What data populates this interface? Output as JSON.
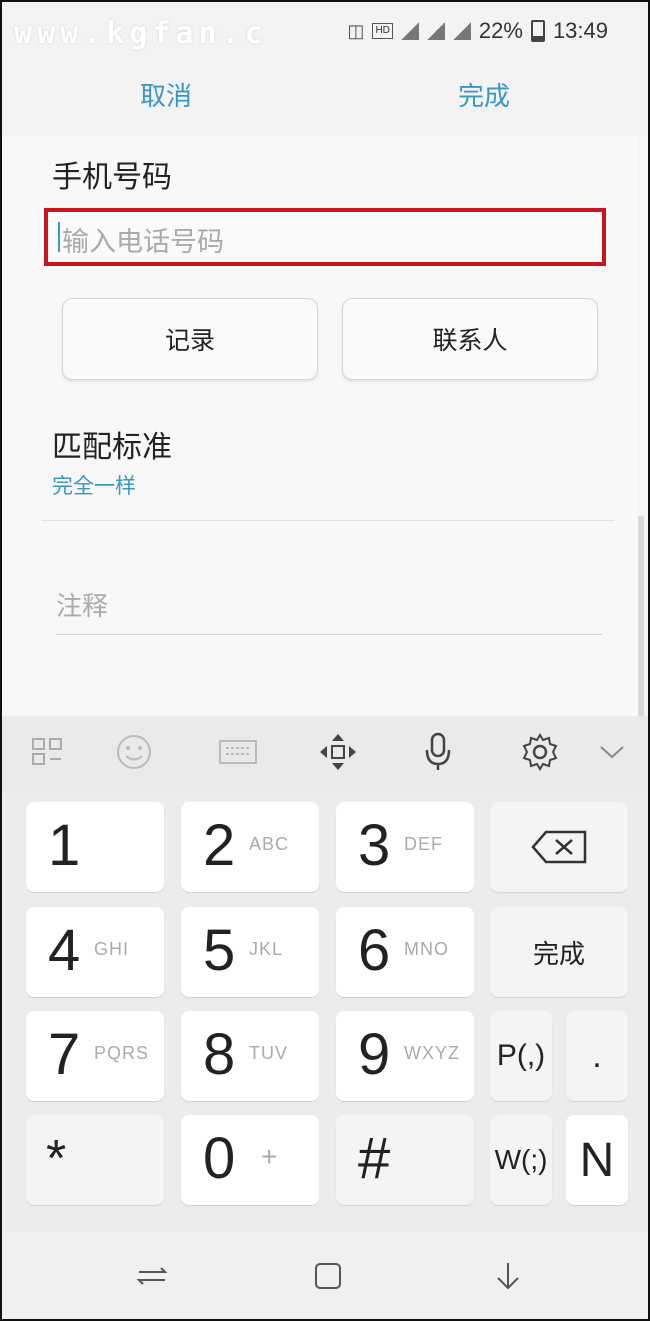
{
  "status_bar": {
    "watermark": "www.kgfan.c",
    "battery": "22%",
    "time": "13:49"
  },
  "action_bar": {
    "cancel": "取消",
    "done": "完成"
  },
  "form": {
    "phone_label": "手机号码",
    "phone_placeholder": "输入电话号码",
    "log_button": "记录",
    "contacts_button": "联系人",
    "match_label": "匹配标准",
    "match_value": "完全一样",
    "notes_placeholder": "注释"
  },
  "keyboard": {
    "toolbar_icons": [
      "grid-icon",
      "emoji-icon",
      "keyboard-icon",
      "move-icon",
      "microphone-icon",
      "gear-icon",
      "chevron-down-icon"
    ],
    "keys": [
      {
        "num": "1",
        "letters": ""
      },
      {
        "num": "2",
        "letters": "ABC"
      },
      {
        "num": "3",
        "letters": "DEF"
      },
      {
        "num": "4",
        "letters": "GHI"
      },
      {
        "num": "5",
        "letters": "JKL"
      },
      {
        "num": "6",
        "letters": "MNO"
      },
      {
        "num": "7",
        "letters": "PQRS"
      },
      {
        "num": "8",
        "letters": "TUV"
      },
      {
        "num": "9",
        "letters": "WXYZ"
      },
      {
        "num": "*",
        "letters": ""
      },
      {
        "num": "0",
        "letters": "+"
      },
      {
        "num": "#",
        "letters": ""
      }
    ],
    "done": "完成",
    "pause": "P(,)",
    "period": ".",
    "wait": "W(;)",
    "n": "N"
  },
  "nav_bar": {
    "icons": [
      "recent-apps-icon",
      "home-icon",
      "back-icon"
    ]
  },
  "colors": {
    "accent": "#3a97c2",
    "highlight_border": "#c9151c"
  }
}
